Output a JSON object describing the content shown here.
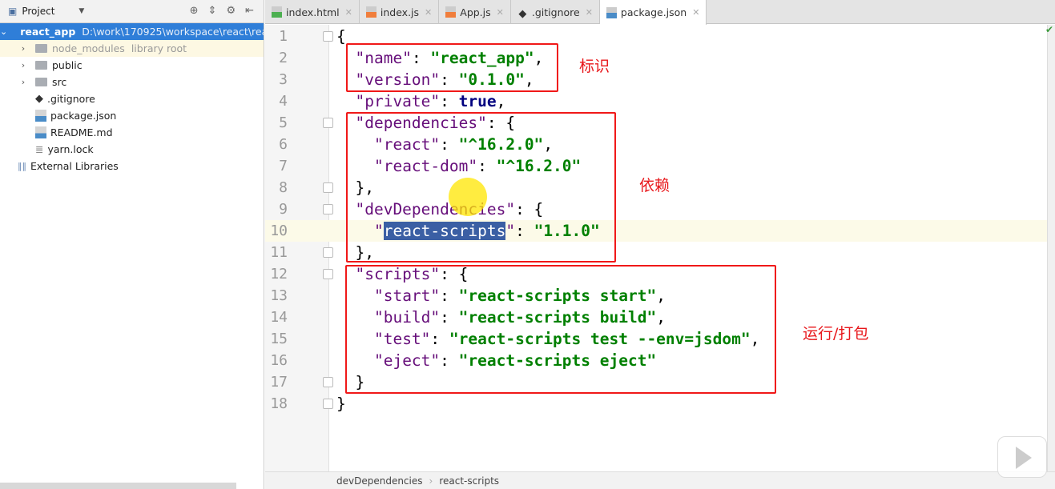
{
  "sidebar": {
    "title": "Project",
    "root": {
      "name": "react_app",
      "path": "D:\\work\\170925\\workspace\\react\\react_app"
    },
    "items": [
      {
        "label": "node_modules",
        "sub": "library root",
        "type": "folder",
        "expandable": true
      },
      {
        "label": "public",
        "type": "folder",
        "expandable": true
      },
      {
        "label": "src",
        "type": "folder",
        "expandable": true
      },
      {
        "label": ".gitignore",
        "type": "git"
      },
      {
        "label": "package.json",
        "type": "json"
      },
      {
        "label": "README.md",
        "type": "md"
      },
      {
        "label": "yarn.lock",
        "type": "text"
      }
    ],
    "external": "External Libraries"
  },
  "tabs": [
    {
      "label": "index.html",
      "icon": "H",
      "color": "#4caf50"
    },
    {
      "label": "index.js",
      "icon": "JS",
      "color": "#f07e3c"
    },
    {
      "label": "App.js",
      "icon": "JS",
      "color": "#f07e3c"
    },
    {
      "label": ".gitignore",
      "icon": "git",
      "color": "#333333"
    },
    {
      "label": "package.json",
      "icon": "JSON",
      "color": "#4a8cc7",
      "active": true
    }
  ],
  "code": [
    [
      [
        "p",
        "{"
      ]
    ],
    [
      [
        "p",
        "  "
      ],
      [
        "k",
        "\"name\""
      ],
      [
        "p",
        ": "
      ],
      [
        "s",
        "\"react_app\""
      ],
      [
        "p",
        ","
      ]
    ],
    [
      [
        "p",
        "  "
      ],
      [
        "k",
        "\"version\""
      ],
      [
        "p",
        ": "
      ],
      [
        "s",
        "\"0.1.0\""
      ],
      [
        "p",
        ","
      ]
    ],
    [
      [
        "p",
        "  "
      ],
      [
        "k",
        "\"private\""
      ],
      [
        "p",
        ": "
      ],
      [
        "b",
        "true"
      ],
      [
        "p",
        ","
      ]
    ],
    [
      [
        "p",
        "  "
      ],
      [
        "k",
        "\"dependencies\""
      ],
      [
        "p",
        ": {"
      ]
    ],
    [
      [
        "p",
        "    "
      ],
      [
        "k",
        "\"react\""
      ],
      [
        "p",
        ": "
      ],
      [
        "s",
        "\"^16.2.0\""
      ],
      [
        "p",
        ","
      ]
    ],
    [
      [
        "p",
        "    "
      ],
      [
        "k",
        "\"react-dom\""
      ],
      [
        "p",
        ": "
      ],
      [
        "s",
        "\"^16.2.0\""
      ]
    ],
    [
      [
        "p",
        "  },"
      ]
    ],
    [
      [
        "p",
        "  "
      ],
      [
        "k",
        "\"devDependencies\""
      ],
      [
        "p",
        ": {"
      ]
    ],
    [
      [
        "p",
        "    "
      ],
      [
        "k",
        "\""
      ],
      [
        "hl",
        "react-scripts"
      ],
      [
        "k",
        "\""
      ],
      [
        "p",
        ": "
      ],
      [
        "s",
        "\"1.1.0\""
      ]
    ],
    [
      [
        "p",
        "  },"
      ]
    ],
    [
      [
        "p",
        "  "
      ],
      [
        "k",
        "\"scripts\""
      ],
      [
        "p",
        ": {"
      ]
    ],
    [
      [
        "p",
        "    "
      ],
      [
        "k",
        "\"start\""
      ],
      [
        "p",
        ": "
      ],
      [
        "s",
        "\"react-scripts start\""
      ],
      [
        "p",
        ","
      ]
    ],
    [
      [
        "p",
        "    "
      ],
      [
        "k",
        "\"build\""
      ],
      [
        "p",
        ": "
      ],
      [
        "s",
        "\"react-scripts build\""
      ],
      [
        "p",
        ","
      ]
    ],
    [
      [
        "p",
        "    "
      ],
      [
        "k",
        "\"test\""
      ],
      [
        "p",
        ": "
      ],
      [
        "s",
        "\"react-scripts test --env=jsdom\""
      ],
      [
        "p",
        ","
      ]
    ],
    [
      [
        "p",
        "    "
      ],
      [
        "k",
        "\"eject\""
      ],
      [
        "p",
        ": "
      ],
      [
        "s",
        "\"react-scripts eject\""
      ]
    ],
    [
      [
        "p",
        "  }"
      ]
    ],
    [
      [
        "p",
        "}"
      ]
    ]
  ],
  "current_line": 10,
  "annotations": {
    "identity": "标识",
    "dependencies": "依赖",
    "scripts": "运行/打包"
  },
  "breadcrumb": [
    "devDependencies",
    "react-scripts"
  ],
  "colors": {
    "annotation": "#f01818",
    "selection": "#2f7ed8"
  }
}
